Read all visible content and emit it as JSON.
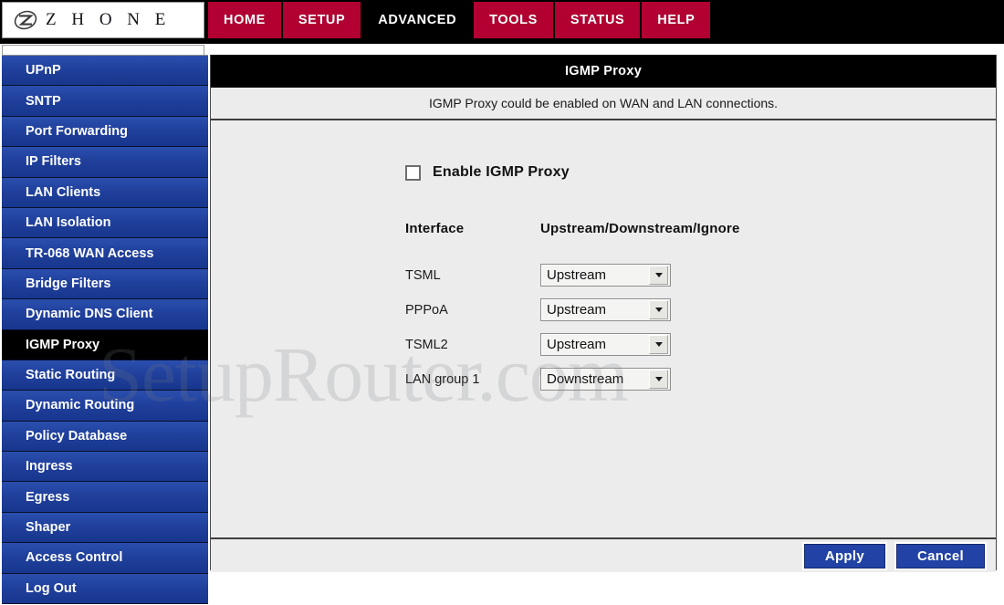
{
  "brand": {
    "name": "Z H O N E",
    "logo_icon": "zhone-z-emblem-icon"
  },
  "nav": {
    "items": [
      {
        "label": "HOME",
        "active": false
      },
      {
        "label": "SETUP",
        "active": false
      },
      {
        "label": "ADVANCED",
        "active": true
      },
      {
        "label": "TOOLS",
        "active": false
      },
      {
        "label": "STATUS",
        "active": false
      },
      {
        "label": "HELP",
        "active": false
      }
    ],
    "accent_color": "#b30032",
    "active_color": "#000000"
  },
  "sidebar": {
    "items": [
      {
        "label": "UPnP",
        "active": false
      },
      {
        "label": "SNTP",
        "active": false
      },
      {
        "label": "Port Forwarding",
        "active": false
      },
      {
        "label": "IP Filters",
        "active": false
      },
      {
        "label": "LAN Clients",
        "active": false
      },
      {
        "label": "LAN Isolation",
        "active": false
      },
      {
        "label": "TR-068 WAN Access",
        "active": false
      },
      {
        "label": "Bridge Filters",
        "active": false
      },
      {
        "label": "Dynamic DNS Client",
        "active": false
      },
      {
        "label": "IGMP Proxy",
        "active": true
      },
      {
        "label": "Static Routing",
        "active": false
      },
      {
        "label": "Dynamic Routing",
        "active": false
      },
      {
        "label": "Policy Database",
        "active": false
      },
      {
        "label": "Ingress",
        "active": false
      },
      {
        "label": "Egress",
        "active": false
      },
      {
        "label": "Shaper",
        "active": false
      },
      {
        "label": "Access Control",
        "active": false
      },
      {
        "label": "Log Out",
        "active": false
      }
    ],
    "color": "#20409c"
  },
  "panel": {
    "title": "IGMP Proxy",
    "description": "IGMP Proxy could be enabled on WAN and LAN connections.",
    "enable_checkbox": {
      "label": "Enable IGMP Proxy",
      "checked": false
    },
    "table": {
      "headers": {
        "interface": "Interface",
        "mode": "Upstream/Downstream/Ignore"
      },
      "rows": [
        {
          "interface": "TSML",
          "mode": "Upstream"
        },
        {
          "interface": "PPPoA",
          "mode": "Upstream"
        },
        {
          "interface": "TSML2",
          "mode": "Upstream"
        },
        {
          "interface": "LAN group 1",
          "mode": "Downstream"
        }
      ],
      "options": [
        "Upstream",
        "Downstream",
        "Ignore"
      ]
    },
    "buttons": {
      "apply": "Apply",
      "cancel": "Cancel"
    }
  },
  "watermark": {
    "text": "SetupRouter.com"
  }
}
